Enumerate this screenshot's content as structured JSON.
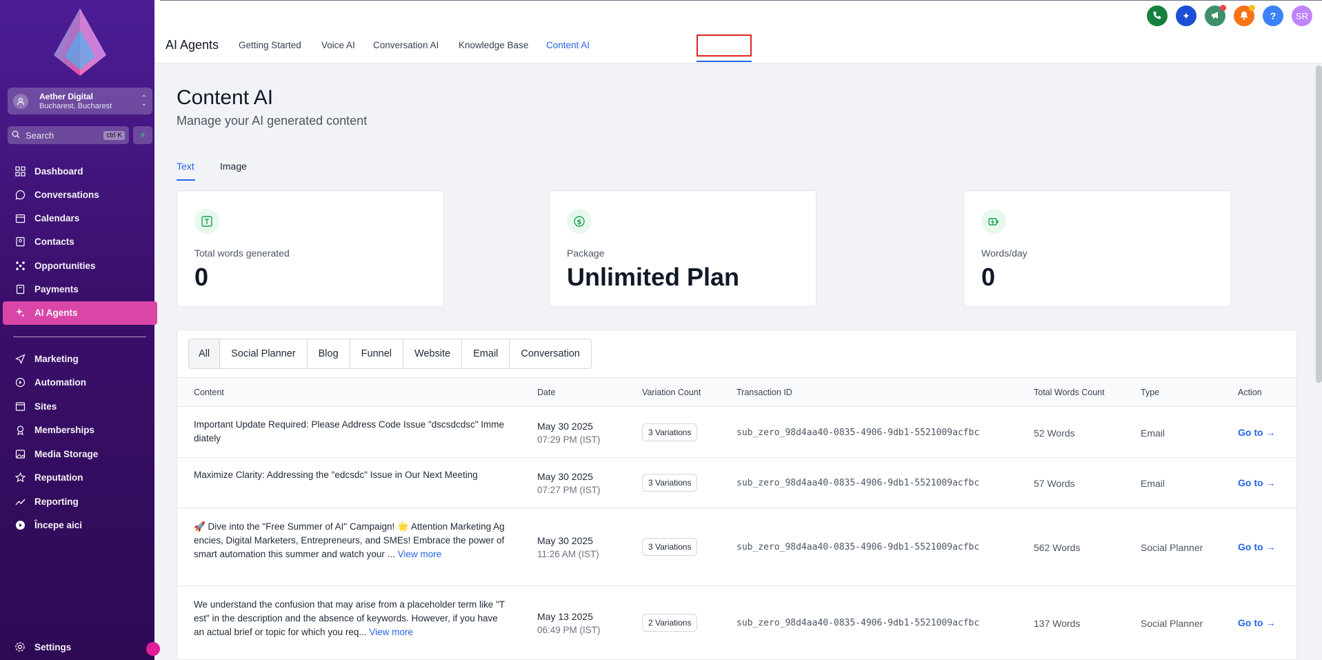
{
  "sidebar": {
    "account": {
      "name": "Aether Digital",
      "location": "Bucharest, Bucharest"
    },
    "search": {
      "placeholder": "Search",
      "shortcut": "ctrl K"
    },
    "items": [
      {
        "label": "Dashboard",
        "icon": "dashboard-icon"
      },
      {
        "label": "Conversations",
        "icon": "chat-icon"
      },
      {
        "label": "Calendars",
        "icon": "calendar-icon"
      },
      {
        "label": "Contacts",
        "icon": "contacts-icon"
      },
      {
        "label": "Opportunities",
        "icon": "opportunities-icon"
      },
      {
        "label": "Payments",
        "icon": "payments-icon"
      },
      {
        "label": "AI Agents",
        "icon": "sparkle-icon",
        "active": true
      }
    ],
    "items2": [
      {
        "label": "Marketing",
        "icon": "send-icon"
      },
      {
        "label": "Automation",
        "icon": "automation-icon"
      },
      {
        "label": "Sites",
        "icon": "sites-icon"
      },
      {
        "label": "Memberships",
        "icon": "memberships-icon"
      },
      {
        "label": "Media Storage",
        "icon": "image-icon"
      },
      {
        "label": "Reputation",
        "icon": "star-icon"
      },
      {
        "label": "Reporting",
        "icon": "trend-icon"
      },
      {
        "label": "Începe aici",
        "icon": "play-icon"
      }
    ],
    "settings_label": "Settings"
  },
  "header": {
    "title": "AI Agents",
    "tabs": [
      "Getting Started",
      "Voice AI",
      "Conversation AI",
      "Knowledge Base",
      "Content AI"
    ],
    "active_tab": "Content AI",
    "user_initials": "SR",
    "help_glyph": "?"
  },
  "main": {
    "title": "Content AI",
    "subtitle": "Manage your AI generated content",
    "subtabs": [
      "Text",
      "Image"
    ],
    "cards": [
      {
        "label": "Total words generated",
        "value": "0",
        "icon": "text-icon"
      },
      {
        "label": "Package",
        "value": "Unlimited Plan",
        "icon": "dollar-icon"
      },
      {
        "label": "Words/day",
        "value": "0",
        "icon": "battery-icon"
      }
    ],
    "filters": [
      "All",
      "Social Planner",
      "Blog",
      "Funnel",
      "Website",
      "Email",
      "Conversation"
    ],
    "columns": [
      "Content",
      "Date",
      "Variation Count",
      "Transaction ID",
      "Total Words Count",
      "Type",
      "Action"
    ],
    "rows": [
      {
        "content": "Important Update Required: Please Address Code Issue \"dscsdcdsc\" Immediately",
        "more": "",
        "date": "May 30 2025",
        "time": "07:29 PM (IST)",
        "variations": "3 Variations",
        "transaction": "sub_zero_98d4aa40-0835-4906-9db1-5521009acfbc",
        "words": "52 Words",
        "type": "Email",
        "action": "Go to"
      },
      {
        "content": "Maximize Clarity: Addressing the \"edcsdc\" Issue in Our Next Meeting",
        "more": "",
        "date": "May 30 2025",
        "time": "07:27 PM (IST)",
        "variations": "3 Variations",
        "transaction": "sub_zero_98d4aa40-0835-4906-9db1-5521009acfbc",
        "words": "57 Words",
        "type": "Email",
        "action": "Go to"
      },
      {
        "content": "🚀 Dive into the \"Free Summer of AI\" Campaign! 🌟 Attention Marketing Agencies, Digital Marketers, Entrepreneurs, and SMEs! Embrace the power of smart automation this summer and watch your ... ",
        "more": "View more",
        "date": "May 30 2025",
        "time": "11:26 AM (IST)",
        "variations": "3 Variations",
        "transaction": "sub_zero_98d4aa40-0835-4906-9db1-5521009acfbc",
        "words": "562 Words",
        "type": "Social Planner",
        "action": "Go to"
      },
      {
        "content": "We understand the confusion that may arise from a placeholder term like \"Test\" in the description and the absence of keywords. However, if you have an actual brief or topic for which you req... ",
        "more": "View more",
        "date": "May 13 2025",
        "time": "06:49 PM (IST)",
        "variations": "2 Variations",
        "transaction": "sub_zero_98d4aa40-0835-4906-9db1-5521009acfbc",
        "words": "137 Words",
        "type": "Social Planner",
        "action": "Go to"
      }
    ]
  },
  "colors": {
    "accent": "#2563eb",
    "sidebar_active": "#d946a8",
    "highlight": "#e02424"
  }
}
